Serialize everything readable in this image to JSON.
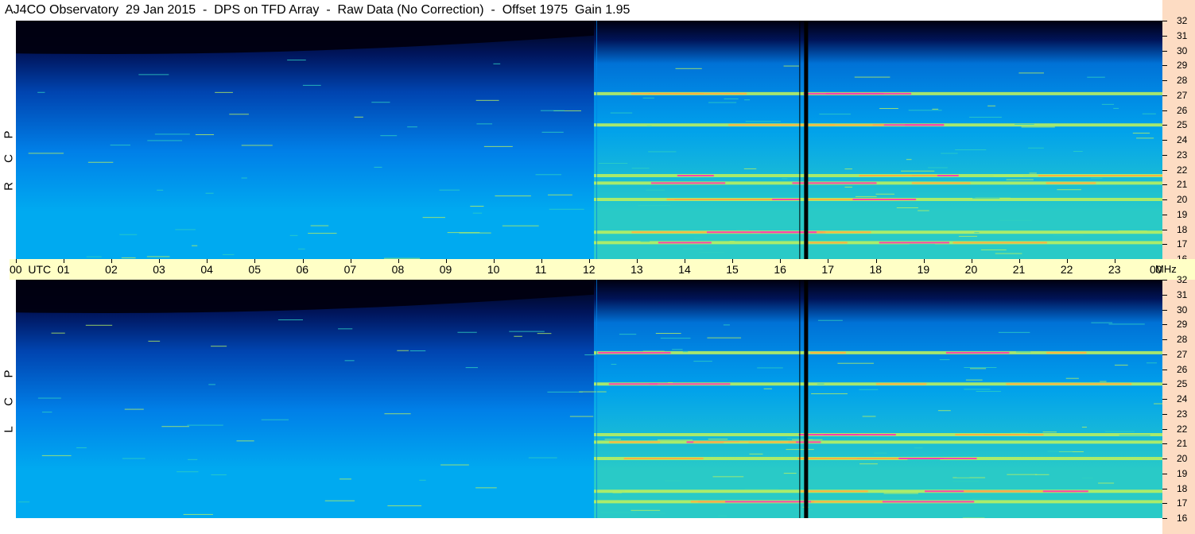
{
  "header": {
    "title": "AJ4CO Observatory  29 Jan 2015  -  DPS on TFD Array  -  Raw Data (No Correction)  -  Offset 1975  Gain 1.95"
  },
  "chart_data": [
    {
      "type": "heatmap",
      "name": "RCP",
      "side_label": [
        "P",
        "C",
        "R"
      ],
      "x_unit": "UTC",
      "x_ticks": [
        "00",
        "01",
        "02",
        "03",
        "04",
        "05",
        "06",
        "07",
        "08",
        "09",
        "10",
        "11",
        "12",
        "13",
        "14",
        "15",
        "16",
        "17",
        "18",
        "19",
        "20",
        "21",
        "22",
        "23",
        "00"
      ],
      "y_unit": "MHz",
      "y_ticks": [
        32,
        31,
        30,
        29,
        28,
        27,
        26,
        25,
        24,
        23,
        22,
        21,
        20,
        19,
        18,
        17,
        16
      ],
      "ylim": [
        16,
        32
      ],
      "xlim": [
        0,
        24
      ],
      "colormap": [
        "#000010",
        "#00155c",
        "#0044b0",
        "#0080e8",
        "#00aaf0",
        "#30d0c0",
        "#b8f060",
        "#ffb040",
        "#ff3cb0"
      ],
      "features": {
        "quiet_cutoff_utc": 12.1,
        "gap_utc": [
          16.4,
          16.55
        ],
        "bands_mhz": [
          27.1,
          25.0,
          21.6,
          21.1,
          20.0,
          17.8,
          17.1
        ]
      }
    },
    {
      "type": "heatmap",
      "name": "LCP",
      "side_label": [
        "P",
        "C",
        "L"
      ],
      "x_unit": "UTC",
      "x_ticks": [
        "00",
        "01",
        "02",
        "03",
        "04",
        "05",
        "06",
        "07",
        "08",
        "09",
        "10",
        "11",
        "12",
        "13",
        "14",
        "15",
        "16",
        "17",
        "18",
        "19",
        "20",
        "21",
        "22",
        "23",
        "00"
      ],
      "y_unit": "MHz",
      "y_ticks": [
        32,
        31,
        30,
        29,
        28,
        27,
        26,
        25,
        24,
        23,
        22,
        21,
        20,
        19,
        18,
        17,
        16
      ],
      "ylim": [
        16,
        32
      ],
      "xlim": [
        0,
        24
      ],
      "colormap": [
        "#000010",
        "#00155c",
        "#0044b0",
        "#0080e8",
        "#00aaf0",
        "#30d0c0",
        "#b8f060",
        "#ffb040",
        "#ff3cb0"
      ],
      "features": {
        "quiet_cutoff_utc": 12.1,
        "gap_utc": [
          16.4,
          16.55
        ],
        "bands_mhz": [
          27.1,
          25.0,
          21.6,
          21.1,
          20.0,
          17.8,
          17.1
        ]
      }
    }
  ],
  "time_axis": {
    "labels": [
      "00  UTC",
      "01",
      "02",
      "03",
      "04",
      "05",
      "06",
      "07",
      "08",
      "09",
      "10",
      "11",
      "12",
      "13",
      "14",
      "15",
      "16",
      "17",
      "18",
      "19",
      "20",
      "21",
      "22",
      "23",
      "00"
    ],
    "unit_label": "MHz"
  }
}
